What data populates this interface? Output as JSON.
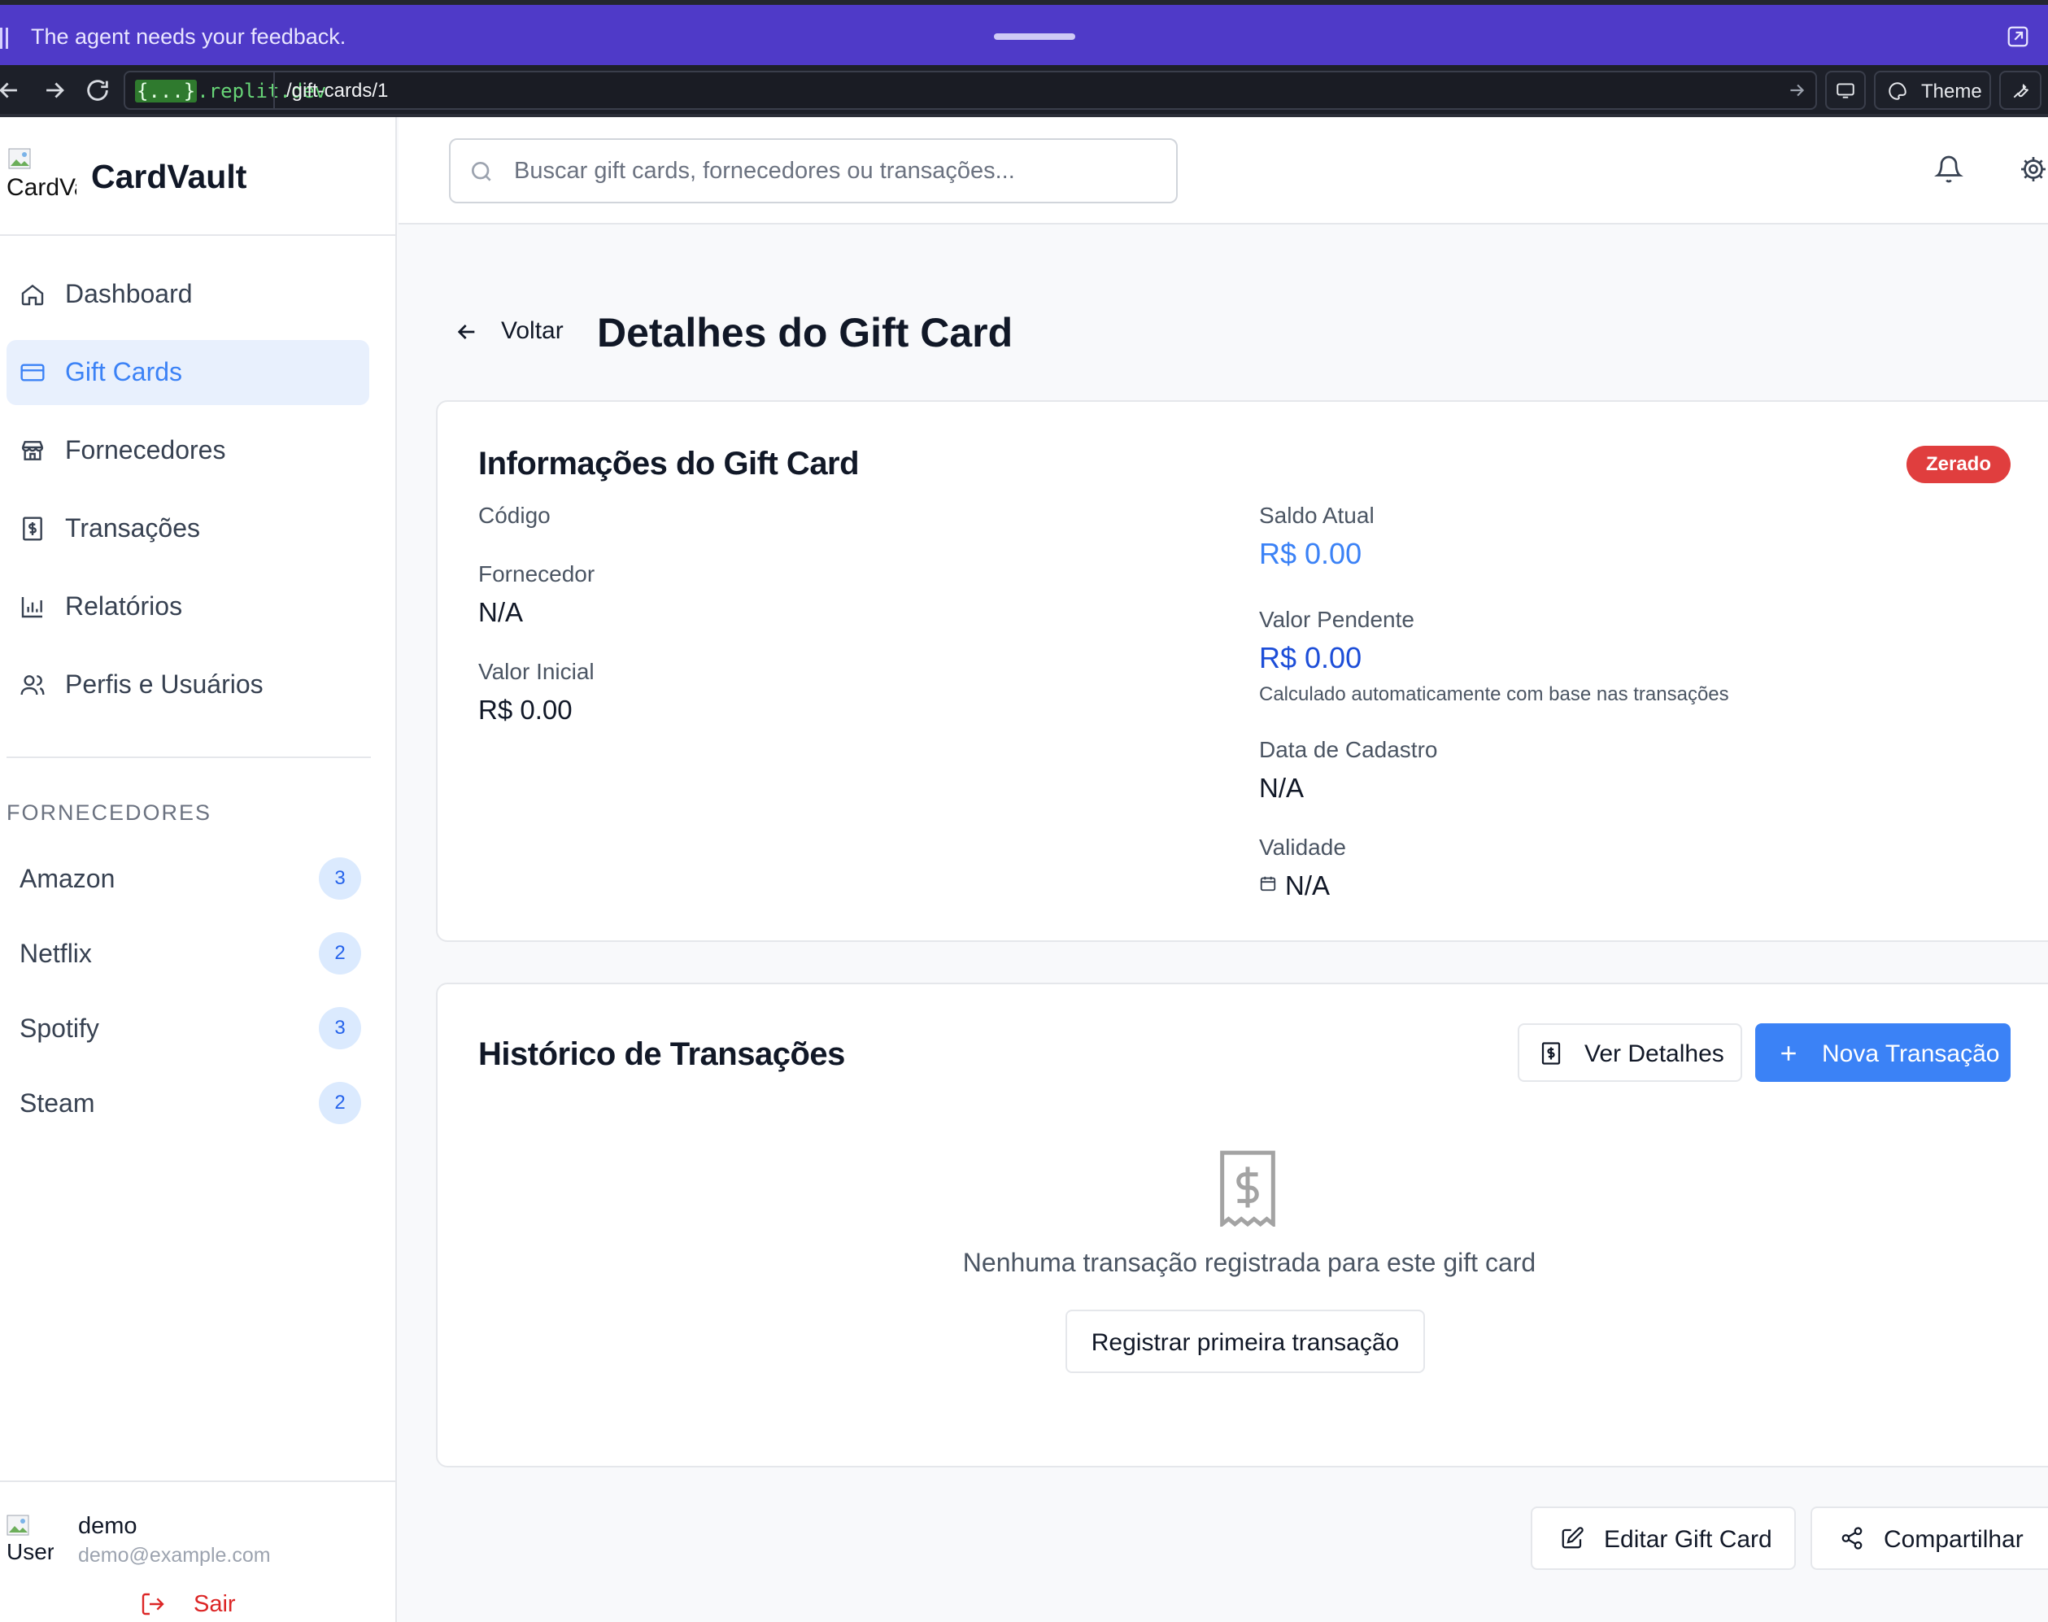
{
  "banner": {
    "message": "The agent needs your feedback."
  },
  "browser": {
    "url_host_brace": "{...}",
    "url_host_rest": ".replit.dev",
    "url_path": "/gift-cards/1",
    "theme_label": "Theme"
  },
  "sidebar": {
    "logo_alt": "CardVault",
    "brand": "CardVault",
    "nav": [
      {
        "label": "Dashboard",
        "icon": "home-icon"
      },
      {
        "label": "Gift Cards",
        "icon": "credit-card-icon"
      },
      {
        "label": "Fornecedores",
        "icon": "store-icon"
      },
      {
        "label": "Transações",
        "icon": "receipt-icon"
      },
      {
        "label": "Relatórios",
        "icon": "bar-chart-icon"
      },
      {
        "label": "Perfis e Usuários",
        "icon": "users-icon"
      }
    ],
    "active_item": "Gift Cards",
    "suppliers_title": "FORNECEDORES",
    "suppliers": [
      {
        "name": "Amazon",
        "count": "3"
      },
      {
        "name": "Netflix",
        "count": "2"
      },
      {
        "name": "Spotify",
        "count": "3"
      },
      {
        "name": "Steam",
        "count": "2"
      }
    ],
    "user": {
      "avatar_alt": "User",
      "name": "demo",
      "email": "demo@example.com"
    },
    "logout_label": "Sair"
  },
  "topbar": {
    "search_placeholder": "Buscar gift cards, fornecedores ou transações..."
  },
  "main": {
    "back_label": "Voltar",
    "page_title": "Detalhes do Gift Card",
    "info": {
      "title": "Informações do Gift Card",
      "status_badge": "Zerado",
      "codigo_label": "Código",
      "codigo_value": "",
      "fornecedor_label": "Fornecedor",
      "fornecedor_value": "N/A",
      "valor_inicial_label": "Valor Inicial",
      "valor_inicial_value": "R$ 0.00",
      "saldo_atual_label": "Saldo Atual",
      "saldo_atual_value": "R$ 0.00",
      "valor_pendente_label": "Valor Pendente",
      "valor_pendente_value": "R$ 0.00",
      "valor_pendente_note": "Calculado automaticamente com base nas transações",
      "data_cadastro_label": "Data de Cadastro",
      "data_cadastro_value": "N/A",
      "validade_label": "Validade",
      "validade_value": "N/A"
    },
    "history": {
      "title": "Histórico de Transações",
      "details_button": "Ver Detalhes",
      "new_button": "Nova Transação",
      "empty_text": "Nenhuma transação registrada para este gift card",
      "first_button": "Registrar primeira transação"
    },
    "edit_button": "Editar Gift Card",
    "share_button": "Compartilhar"
  },
  "colors": {
    "accent": "#3b82f6",
    "active_bg": "#e8f0fd",
    "banner": "#4f3ac8",
    "badge_red": "#e03e3e",
    "logout_red": "#dc2626"
  }
}
